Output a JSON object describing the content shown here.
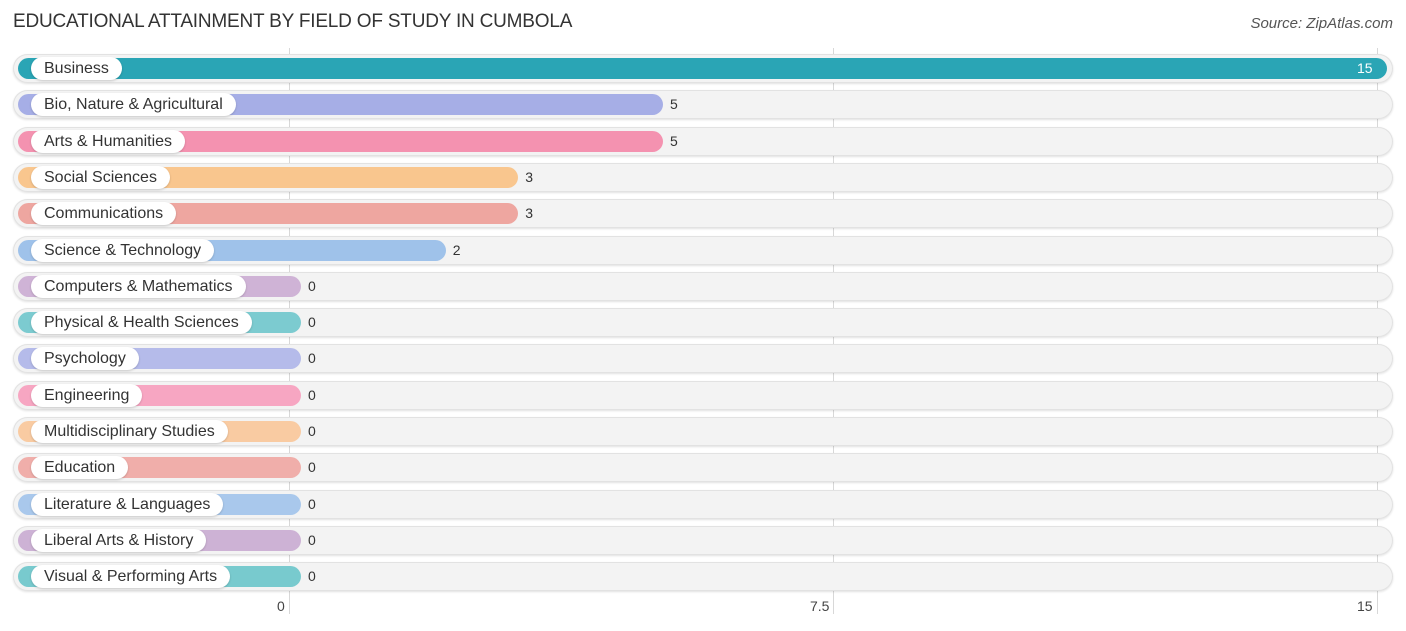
{
  "header": {
    "title": "EDUCATIONAL ATTAINMENT BY FIELD OF STUDY IN CUMBOLA",
    "source": "Source: ZipAtlas.com"
  },
  "chart_data": {
    "type": "bar",
    "orientation": "horizontal",
    "title": "EDUCATIONAL ATTAINMENT BY FIELD OF STUDY IN CUMBOLA",
    "xlabel": "",
    "ylabel": "",
    "xlim": [
      0,
      15
    ],
    "x_ticks": [
      "0",
      "7.5",
      "15"
    ],
    "grid": true,
    "categories": [
      "Business",
      "Bio, Nature & Agricultural",
      "Arts & Humanities",
      "Social Sciences",
      "Communications",
      "Science & Technology",
      "Computers & Mathematics",
      "Physical & Health Sciences",
      "Psychology",
      "Engineering",
      "Multidisciplinary Studies",
      "Education",
      "Literature & Languages",
      "Liberal Arts & History",
      "Visual & Performing Arts"
    ],
    "values": [
      15,
      5,
      5,
      3,
      3,
      2,
      0,
      0,
      0,
      0,
      0,
      0,
      0,
      0,
      0
    ],
    "colors": [
      "#2aa5b5",
      "#a6aee6",
      "#f492b0",
      "#f9c68e",
      "#eea6a0",
      "#9fc2ea",
      "#cfb3d6",
      "#7ccbd0",
      "#b5bbea",
      "#f7a6c2",
      "#f9cba2",
      "#f0aeaa",
      "#a9c8ec",
      "#cdb2d5",
      "#78cace"
    ]
  }
}
